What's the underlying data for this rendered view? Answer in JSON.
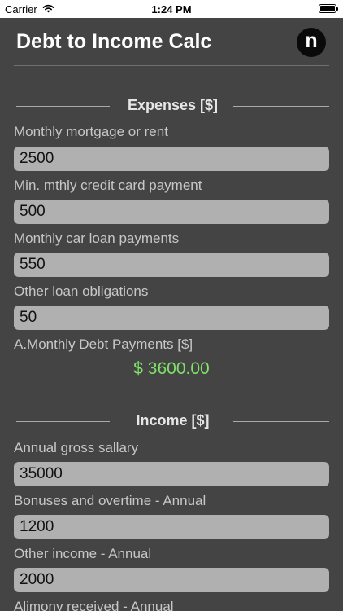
{
  "status_bar": {
    "carrier": "Carrier",
    "time": "1:24 PM",
    "wifi_icon": "wifi-icon",
    "battery_icon": "battery-icon"
  },
  "header": {
    "title": "Debt to Income Calc",
    "logo_letter": "n"
  },
  "expenses": {
    "section_title": "Expenses [$]",
    "fields": [
      {
        "label": "Monthly mortgage or rent",
        "value": "2500"
      },
      {
        "label": "Min. mthly credit card payment",
        "value": "500"
      },
      {
        "label": "Monthly car loan payments",
        "value": "550"
      },
      {
        "label": "Other loan obligations",
        "value": "50"
      }
    ],
    "result_label": "A.Monthly Debt Payments [$]",
    "result_value": "$ 3600.00"
  },
  "income": {
    "section_title": "Income [$]",
    "fields": [
      {
        "label": "Annual gross sallary",
        "value": "35000"
      },
      {
        "label": "Bonuses and overtime - Annual",
        "value": "1200"
      },
      {
        "label": "Other income - Annual",
        "value": "2000"
      },
      {
        "label": "Alimony received - Annual",
        "value": ""
      }
    ]
  },
  "colors": {
    "background": "#444444",
    "input_background": "#b0b0b0",
    "result_green": "#7fe06a"
  }
}
